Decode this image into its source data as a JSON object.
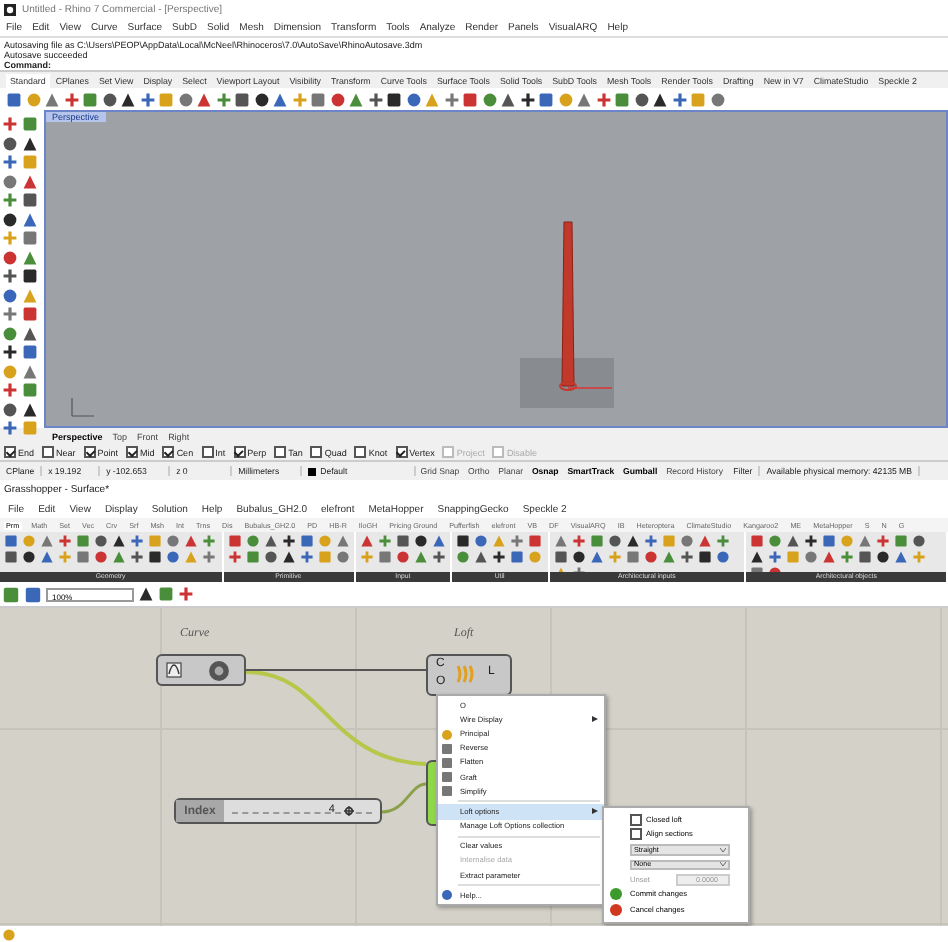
{
  "rhino": {
    "title": "Untitled - Rhino 7 Commercial - [Perspective]",
    "menu": [
      "File",
      "Edit",
      "View",
      "Curve",
      "Surface",
      "SubD",
      "Solid",
      "Mesh",
      "Dimension",
      "Transform",
      "Tools",
      "Analyze",
      "Render",
      "Panels",
      "VisualARQ",
      "Help"
    ],
    "command_history": [
      "Autosaving file as C:\\Users\\PEOP\\AppData\\Local\\McNeel\\Rhinoceros\\7.0\\AutoSave\\RhinoAutosave.3dm",
      "Autosave succeeded"
    ],
    "command_prompt": "Command:",
    "toolbar_tabs": [
      {
        "label": "Standard",
        "selected": true
      },
      {
        "label": "CPlanes",
        "selected": false
      },
      {
        "label": "Set View",
        "selected": false
      },
      {
        "label": "Display",
        "selected": false
      },
      {
        "label": "Select",
        "selected": false
      },
      {
        "label": "Viewport Layout",
        "selected": false
      },
      {
        "label": "Visibility",
        "selected": false
      },
      {
        "label": "Transform",
        "selected": false
      },
      {
        "label": "Curve Tools",
        "selected": false
      },
      {
        "label": "Surface Tools",
        "selected": false
      },
      {
        "label": "Solid Tools",
        "selected": false
      },
      {
        "label": "SubD Tools",
        "selected": false
      },
      {
        "label": "Mesh Tools",
        "selected": false
      },
      {
        "label": "Render Tools",
        "selected": false
      },
      {
        "label": "Drafting",
        "selected": false
      },
      {
        "label": "New in V7",
        "selected": false
      },
      {
        "label": "ClimateStudio",
        "selected": false
      },
      {
        "label": "Speckle 2",
        "selected": false
      }
    ],
    "viewport": {
      "label": "Perspective"
    },
    "viewport_tabs": [
      {
        "label": "Perspective",
        "selected": true
      },
      {
        "label": "Top",
        "selected": false
      },
      {
        "label": "Front",
        "selected": false
      },
      {
        "label": "Right",
        "selected": false
      }
    ],
    "osnaps": [
      {
        "label": "End",
        "checked": true,
        "disabled": false
      },
      {
        "label": "Near",
        "checked": false,
        "disabled": false
      },
      {
        "label": "Point",
        "checked": true,
        "disabled": false
      },
      {
        "label": "Mid",
        "checked": true,
        "disabled": false
      },
      {
        "label": "Cen",
        "checked": true,
        "disabled": false
      },
      {
        "label": "Int",
        "checked": false,
        "disabled": false
      },
      {
        "label": "Perp",
        "checked": true,
        "disabled": false
      },
      {
        "label": "Tan",
        "checked": false,
        "disabled": false
      },
      {
        "label": "Quad",
        "checked": false,
        "disabled": false
      },
      {
        "label": "Knot",
        "checked": false,
        "disabled": false
      },
      {
        "label": "Vertex",
        "checked": true,
        "disabled": false
      },
      {
        "label": "Project",
        "checked": false,
        "disabled": true
      },
      {
        "label": "Disable",
        "checked": false,
        "disabled": true
      }
    ],
    "status_bar": {
      "cplane": "CPlane",
      "x": "x 19.192",
      "y": "y -102.653",
      "z": "z 0",
      "units": "Millimeters",
      "layer": "Default",
      "toggles": [
        {
          "label": "Grid Snap",
          "on": false
        },
        {
          "label": "Ortho",
          "on": false
        },
        {
          "label": "Planar",
          "on": false
        },
        {
          "label": "Osnap",
          "on": true
        },
        {
          "label": "SmartTrack",
          "on": true
        },
        {
          "label": "Gumball",
          "on": true
        },
        {
          "label": "Record History",
          "on": false
        }
      ],
      "filter": "Filter",
      "memory": "Available physical memory: 42135 MB"
    }
  },
  "grasshopper": {
    "title": "Grasshopper - Surface*",
    "menu": [
      "File",
      "Edit",
      "View",
      "Display",
      "Solution",
      "Help",
      "Bubalus_GH2.0",
      "elefront",
      "MetaHopper",
      "SnappingGecko",
      "Speckle 2"
    ],
    "tabs": [
      {
        "label": "Prm",
        "selected": true
      },
      {
        "label": "Math",
        "selected": false
      },
      {
        "label": "Set",
        "selected": false
      },
      {
        "label": "Vec",
        "selected": false
      },
      {
        "label": "Crv",
        "selected": false
      },
      {
        "label": "Srf",
        "selected": false
      },
      {
        "label": "Msh",
        "selected": false
      },
      {
        "label": "Int",
        "selected": false
      },
      {
        "label": "Trns",
        "selected": false
      },
      {
        "label": "Dis",
        "selected": false
      },
      {
        "label": "Bubalus_GH2.0",
        "selected": false
      },
      {
        "label": "PD",
        "selected": false
      },
      {
        "label": "HB-R",
        "selected": false
      },
      {
        "label": "IloGH",
        "selected": false
      },
      {
        "label": "Pricing Ground",
        "selected": false
      },
      {
        "label": "Pufferfish",
        "selected": false
      },
      {
        "label": "elefront",
        "selected": false
      },
      {
        "label": "VB",
        "selected": false
      },
      {
        "label": "DF",
        "selected": false
      },
      {
        "label": "VisualARQ",
        "selected": false
      },
      {
        "label": "IB",
        "selected": false
      },
      {
        "label": "Heteroptera",
        "selected": false
      },
      {
        "label": "ClimateStudio",
        "selected": false
      },
      {
        "label": "Kangaroo2",
        "selected": false
      },
      {
        "label": "ME",
        "selected": false
      },
      {
        "label": "MetaHopper",
        "selected": false
      },
      {
        "label": "S",
        "selected": false
      },
      {
        "label": "N",
        "selected": false
      },
      {
        "label": "G",
        "selected": false
      }
    ],
    "panel_groups": [
      "Geometry",
      "Primitive",
      "Input",
      "Util",
      "Architectural inputs",
      "Architectural objects"
    ],
    "zoom": "100%",
    "components": [
      {
        "kind": "param",
        "name": "Curve"
      },
      {
        "kind": "loft",
        "name": "Loft",
        "inputs": [
          "C",
          "O"
        ],
        "output": "L"
      }
    ],
    "slider": {
      "label": "Index",
      "value": "4",
      "level": 0.8
    },
    "context_menu": [
      {
        "kind": "name",
        "label": "O",
        "selected": false,
        "disabled": false
      },
      {
        "kind": "submenu",
        "label": "Wire Display",
        "selected": false,
        "disabled": false
      },
      {
        "kind": "icon",
        "label": "Principal",
        "selected": false,
        "disabled": false
      },
      {
        "kind": "icon",
        "label": "Reverse",
        "selected": false,
        "disabled": false
      },
      {
        "kind": "icon",
        "label": "Flatten",
        "selected": false,
        "disabled": false
      },
      {
        "kind": "icon",
        "label": "Graft",
        "selected": false,
        "disabled": false
      },
      {
        "kind": "icon",
        "label": "Simplify",
        "selected": false,
        "disabled": false
      },
      {
        "kind": "separator"
      },
      {
        "kind": "submenu",
        "label": "Loft options",
        "selected": true,
        "disabled": false
      },
      {
        "kind": "plain",
        "label": "Manage Loft Options collection",
        "selected": false,
        "disabled": false
      },
      {
        "kind": "separator"
      },
      {
        "kind": "plain",
        "label": "Clear values",
        "selected": false,
        "disabled": false
      },
      {
        "kind": "plain",
        "label": "Internalise data",
        "selected": false,
        "disabled": true
      },
      {
        "kind": "plain",
        "label": "Extract parameter",
        "selected": false,
        "disabled": false
      },
      {
        "kind": "separator"
      },
      {
        "kind": "icon",
        "label": "Help...",
        "selected": false,
        "disabled": false
      }
    ],
    "submenu": [
      {
        "kind": "checkbox",
        "label": "Closed loft",
        "checked": false
      },
      {
        "kind": "checkbox",
        "label": "Align sections",
        "checked": false
      },
      {
        "kind": "dropdown",
        "value": "Straight"
      },
      {
        "kind": "dropdown",
        "value": "None"
      },
      {
        "kind": "spinner",
        "label": "Unset",
        "value": "0.0000",
        "disabled": true
      },
      {
        "kind": "action",
        "label": "Commit changes",
        "color": "#3a9a2a"
      },
      {
        "kind": "action",
        "label": "Cancel changes",
        "color": "#d0391f"
      }
    ]
  }
}
